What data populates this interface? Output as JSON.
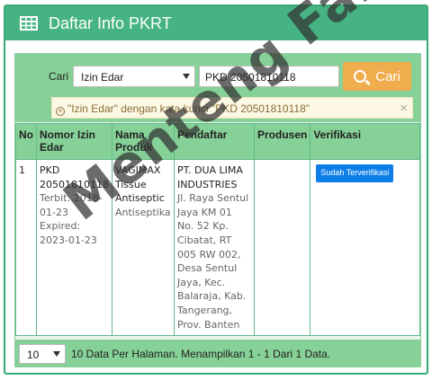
{
  "header": {
    "title": "Daftar Info PKRT",
    "icon": "table-icon"
  },
  "search": {
    "label": "Cari",
    "field_selected": "Izin Edar",
    "query_value": "PKD 20501810118",
    "button_label": "Cari"
  },
  "alert": {
    "text": "\"Izin Edar\" dengan kata kunci \"PKD 20501810118\""
  },
  "table": {
    "headers": [
      "No",
      "Nomor Izin Edar",
      "Nama Produk",
      "Pendaftar",
      "Produsen",
      "Verifikasi"
    ],
    "rows": [
      {
        "no": "1",
        "nomor": "PKD 20501810118",
        "terbit": "Terbit: 2018-01-23",
        "expired": "Expired: 2023-01-23",
        "produk": "VAGIMAX Tissue Antiseptic",
        "produk_sub": "Antiseptika",
        "pendaftar": "PT. DUA LIMA INDUSTRIES",
        "alamat": "Jl. Raya Sentul Jaya KM 01 No. 52 Kp. Cibatat, RT 005 RW 002, Desa Sentul Jaya, Kec. Balaraja, Kab. Tangerang, Prov. Banten",
        "produsen": "",
        "verifikasi": "Sudah Terverifikasi"
      }
    ]
  },
  "footer": {
    "per_page": "10",
    "text": "10 Data Per Halaman. Menampilkan 1 - 1 Dari 1 Data."
  },
  "watermark": "Menteng Farma",
  "colors": {
    "header": "#46b383",
    "row_green": "#86d197",
    "button": "#f0ad4e",
    "badge": "#0d7ee8"
  }
}
